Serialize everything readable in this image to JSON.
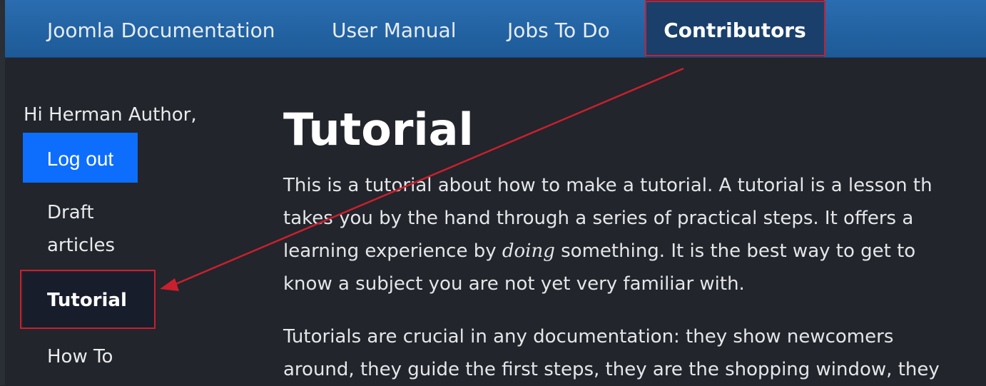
{
  "nav": {
    "items": [
      {
        "label": "Joomla Documentation"
      },
      {
        "label": "User Manual"
      },
      {
        "label": "Jobs To Do"
      },
      {
        "label": "Contributors"
      }
    ]
  },
  "sidebar": {
    "greeting": "Hi Herman Author,",
    "logout_label": "Log out",
    "links": [
      {
        "label_line1": "Draft",
        "label_line2": "articles"
      },
      {
        "label": "Tutorial"
      },
      {
        "label": "How To"
      }
    ]
  },
  "article": {
    "title": "Tutorial",
    "para1_lines": [
      "This is a tutorial about how to make a tutorial. A tutorial is a lesson th",
      "takes you by the hand through a series of practical steps. It offers a",
      "learning experience by ",
      "doing",
      " something. It is the best way to get to",
      "know a subject you are not yet very familiar with."
    ],
    "para2_lines": [
      "Tutorials are crucial in any documentation: they show newcomers",
      "around, they guide the first steps, they are the shopping window, they"
    ]
  },
  "annotation": {
    "color": "#c8202e"
  }
}
